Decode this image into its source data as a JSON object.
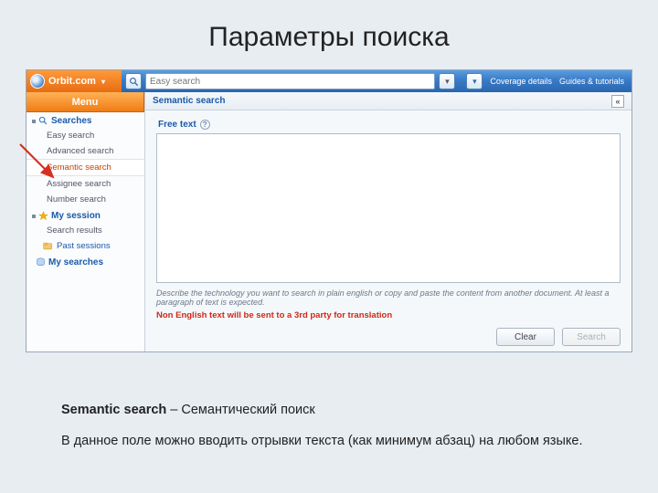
{
  "slide": {
    "title": "Параметры поиска"
  },
  "topbar": {
    "brand": "Orbit.com",
    "search_placeholder": "Easy search",
    "coverage": "Coverage details",
    "guides": "Guides & tutorials"
  },
  "menu_button": "Menu",
  "sidebar": {
    "group_searches": "Searches",
    "items": [
      {
        "label": "Easy search"
      },
      {
        "label": "Advanced search"
      },
      {
        "label": "Semantic search"
      },
      {
        "label": "Assignee search"
      },
      {
        "label": "Number search"
      }
    ],
    "group_session": "My session",
    "session_items": [
      {
        "label": "Search results"
      },
      {
        "label": "Past sessions"
      }
    ],
    "group_searches2": "My searches"
  },
  "main": {
    "crumb": "Semantic search",
    "field_label": "Free text",
    "hint1": "Describe the technology you want to search in plain english or copy and paste the content from another document. At least a paragraph of text is expected.",
    "hint2": "Non English text will be sent to a 3rd party for translation",
    "btn_clear": "Clear",
    "btn_search": "Search"
  },
  "caption": {
    "term": "Semantic search",
    "def": " – Семантический поиск",
    "desc": "В данное поле можно вводить отрывки текста (как минимум абзац) на любом языке."
  }
}
